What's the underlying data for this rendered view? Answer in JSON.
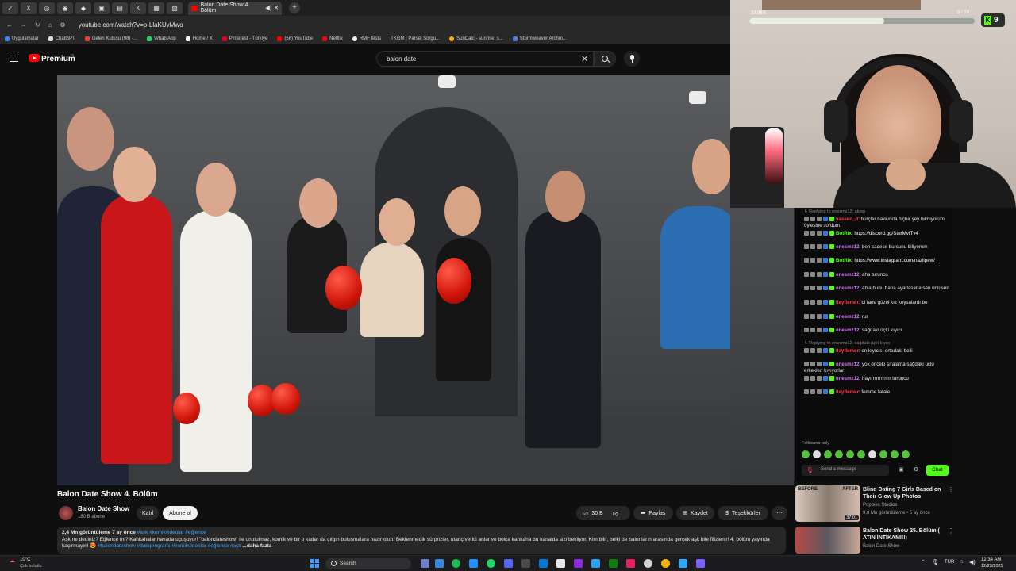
{
  "browser": {
    "active_tab_title": "Balon Date Show 4. Bölüm",
    "pinned_tabs": [
      "tab-1",
      "tab-2",
      "tab-3",
      "tab-4",
      "tab-5",
      "tab-6",
      "tab-7",
      "tab-8",
      "tab-9",
      "tab-10"
    ],
    "url": "youtube.com/watch?v=p-LlaKUvMwo",
    "bookmarks": [
      "Uygulamalar",
      "ChatGPT",
      "Gelen Kutusu (98) -...",
      "WhatsApp",
      "Home / X",
      "Pinterest - Türkiye",
      "(58) YouTube",
      "Netflix",
      "RMF tests",
      "TKGM | Parsel Sorgu...",
      "SunCalc - sunrise, s...",
      "Stormweaver Archm..."
    ]
  },
  "youtube": {
    "logo_text": "Premium",
    "logo_region": "TR",
    "search_value": "balon date",
    "video": {
      "title": "Balon Date Show 4. Bölüm",
      "channel": "Balon Date Show",
      "subscribers": "180 B abone",
      "join_label": "Katıl",
      "subscribe_label": "Abone ol",
      "likes": "30 B",
      "share_label": "Paylaş",
      "save_label": "Kaydet",
      "thanks_label": "Teşekkürler",
      "views_date": "2,4 Mn görüntüleme  7 ay önce",
      "top_tags": "#aşk #komikvideolar #eğlence",
      "description": "Aşk mı dediniz? Eğlence mi? Kahkahalar havada uçuşuyor! \"balondateshow\" ile unutulmaz, komik ve bir o kadar da çılgın buluşmalara hazır olun. Beklenmedik sürprizler, utanç verici anlar ve bolca kahkaha bu kanalda sizi bekliyor. Kim bilir, belki de balonların arasında gerçek aşk bile filizlenir! 4. bölüm yayında kaçırmayın! 😍",
      "bottom_tags": "#balondateshow #dateprogramı #komikvideolar #eğlence #aşk",
      "more_label": "...daha fazla"
    },
    "recommendations": [
      {
        "title": "Blind Dating 7 Girls Based on Their Glow Up Photos",
        "channel": "Poppies Studios",
        "meta": "9,8 Mn görüntüleme • 5 ay önce",
        "duration": "37:01",
        "thumb_label_left": "BEFORE",
        "thumb_label_right": "AFTER"
      },
      {
        "title": "Balon Date Show 25. Bölüm ( ATIN İNTİKAMI!!)",
        "channel": "Balon Date Show",
        "meta": ""
      }
    ]
  },
  "stream": {
    "subgoal_label": "SUBS",
    "subgoal_count": "6 / 10",
    "subgoal_progress": 0.6,
    "viewer_count": "9",
    "chat": [
      {
        "type": "reply",
        "text": "Replying to enesmz12: akrep"
      },
      {
        "type": "msg",
        "user": "yaseen_d",
        "color": "#ff3c4b",
        "text": ": burçlar hakkında hiçbir şey bilmiyorum öylesine sordum"
      },
      {
        "type": "msg",
        "user": "BotRix",
        "color": "#53fc18",
        "text": ": ",
        "link": "https://discord.gg/SturMvfTv4"
      },
      {
        "type": "msg",
        "user": "enesmz12",
        "color": "#d877ff",
        "text": ": ben sadece burcunu biliyorum"
      },
      {
        "type": "msg",
        "user": "BotRix",
        "color": "#53fc18",
        "text": ": ",
        "link": "https://www.instagram.com/nazlipew/"
      },
      {
        "type": "msg",
        "user": "enesmz12",
        "color": "#d877ff",
        "text": ": aha turuncu"
      },
      {
        "type": "msg",
        "user": "enesmz12",
        "color": "#d877ff",
        "text": ": abla bunu bana ayarlasana sen ünlüsün"
      },
      {
        "type": "msg",
        "user": "llayflemer",
        "color": "#ff3c4b",
        "text": ": bi tane güzel kız koysalardı be"
      },
      {
        "type": "msg",
        "user": "enesmz12",
        "color": "#d877ff",
        "text": ": rur"
      },
      {
        "type": "msg",
        "user": "enesmz12",
        "color": "#d877ff",
        "text": ": sağdaki üçlü kıyıcı"
      },
      {
        "type": "reply",
        "text": "Replying to enesmz12: sağdaki üçlü kıyıcı"
      },
      {
        "type": "msg",
        "user": "llayflemer",
        "color": "#ff3c4b",
        "text": ": en kıyıcısı ortadaki belli"
      },
      {
        "type": "msg",
        "user": "enesmz12",
        "color": "#d877ff",
        "text": ": yok önceki sıralama sağdaki üçlü erkekleri kıyıyorlar"
      },
      {
        "type": "msg",
        "user": "enesmz12",
        "color": "#d877ff",
        "text": ": hayırrrrrrrrrrrr turuncu"
      },
      {
        "type": "msg",
        "user": "llayflemer",
        "color": "#ff3c4b",
        "text": ": femme fatale"
      }
    ],
    "followers_only": "Followers only",
    "input_placeholder": "Send a message",
    "chat_button": "Chat"
  },
  "taskbar": {
    "weather_temp": "10°C",
    "weather_desc": "Çok bulutlu",
    "search_label": "Search",
    "lang": "TUR",
    "time": "12:34 AM",
    "date": "12/23/2025"
  }
}
